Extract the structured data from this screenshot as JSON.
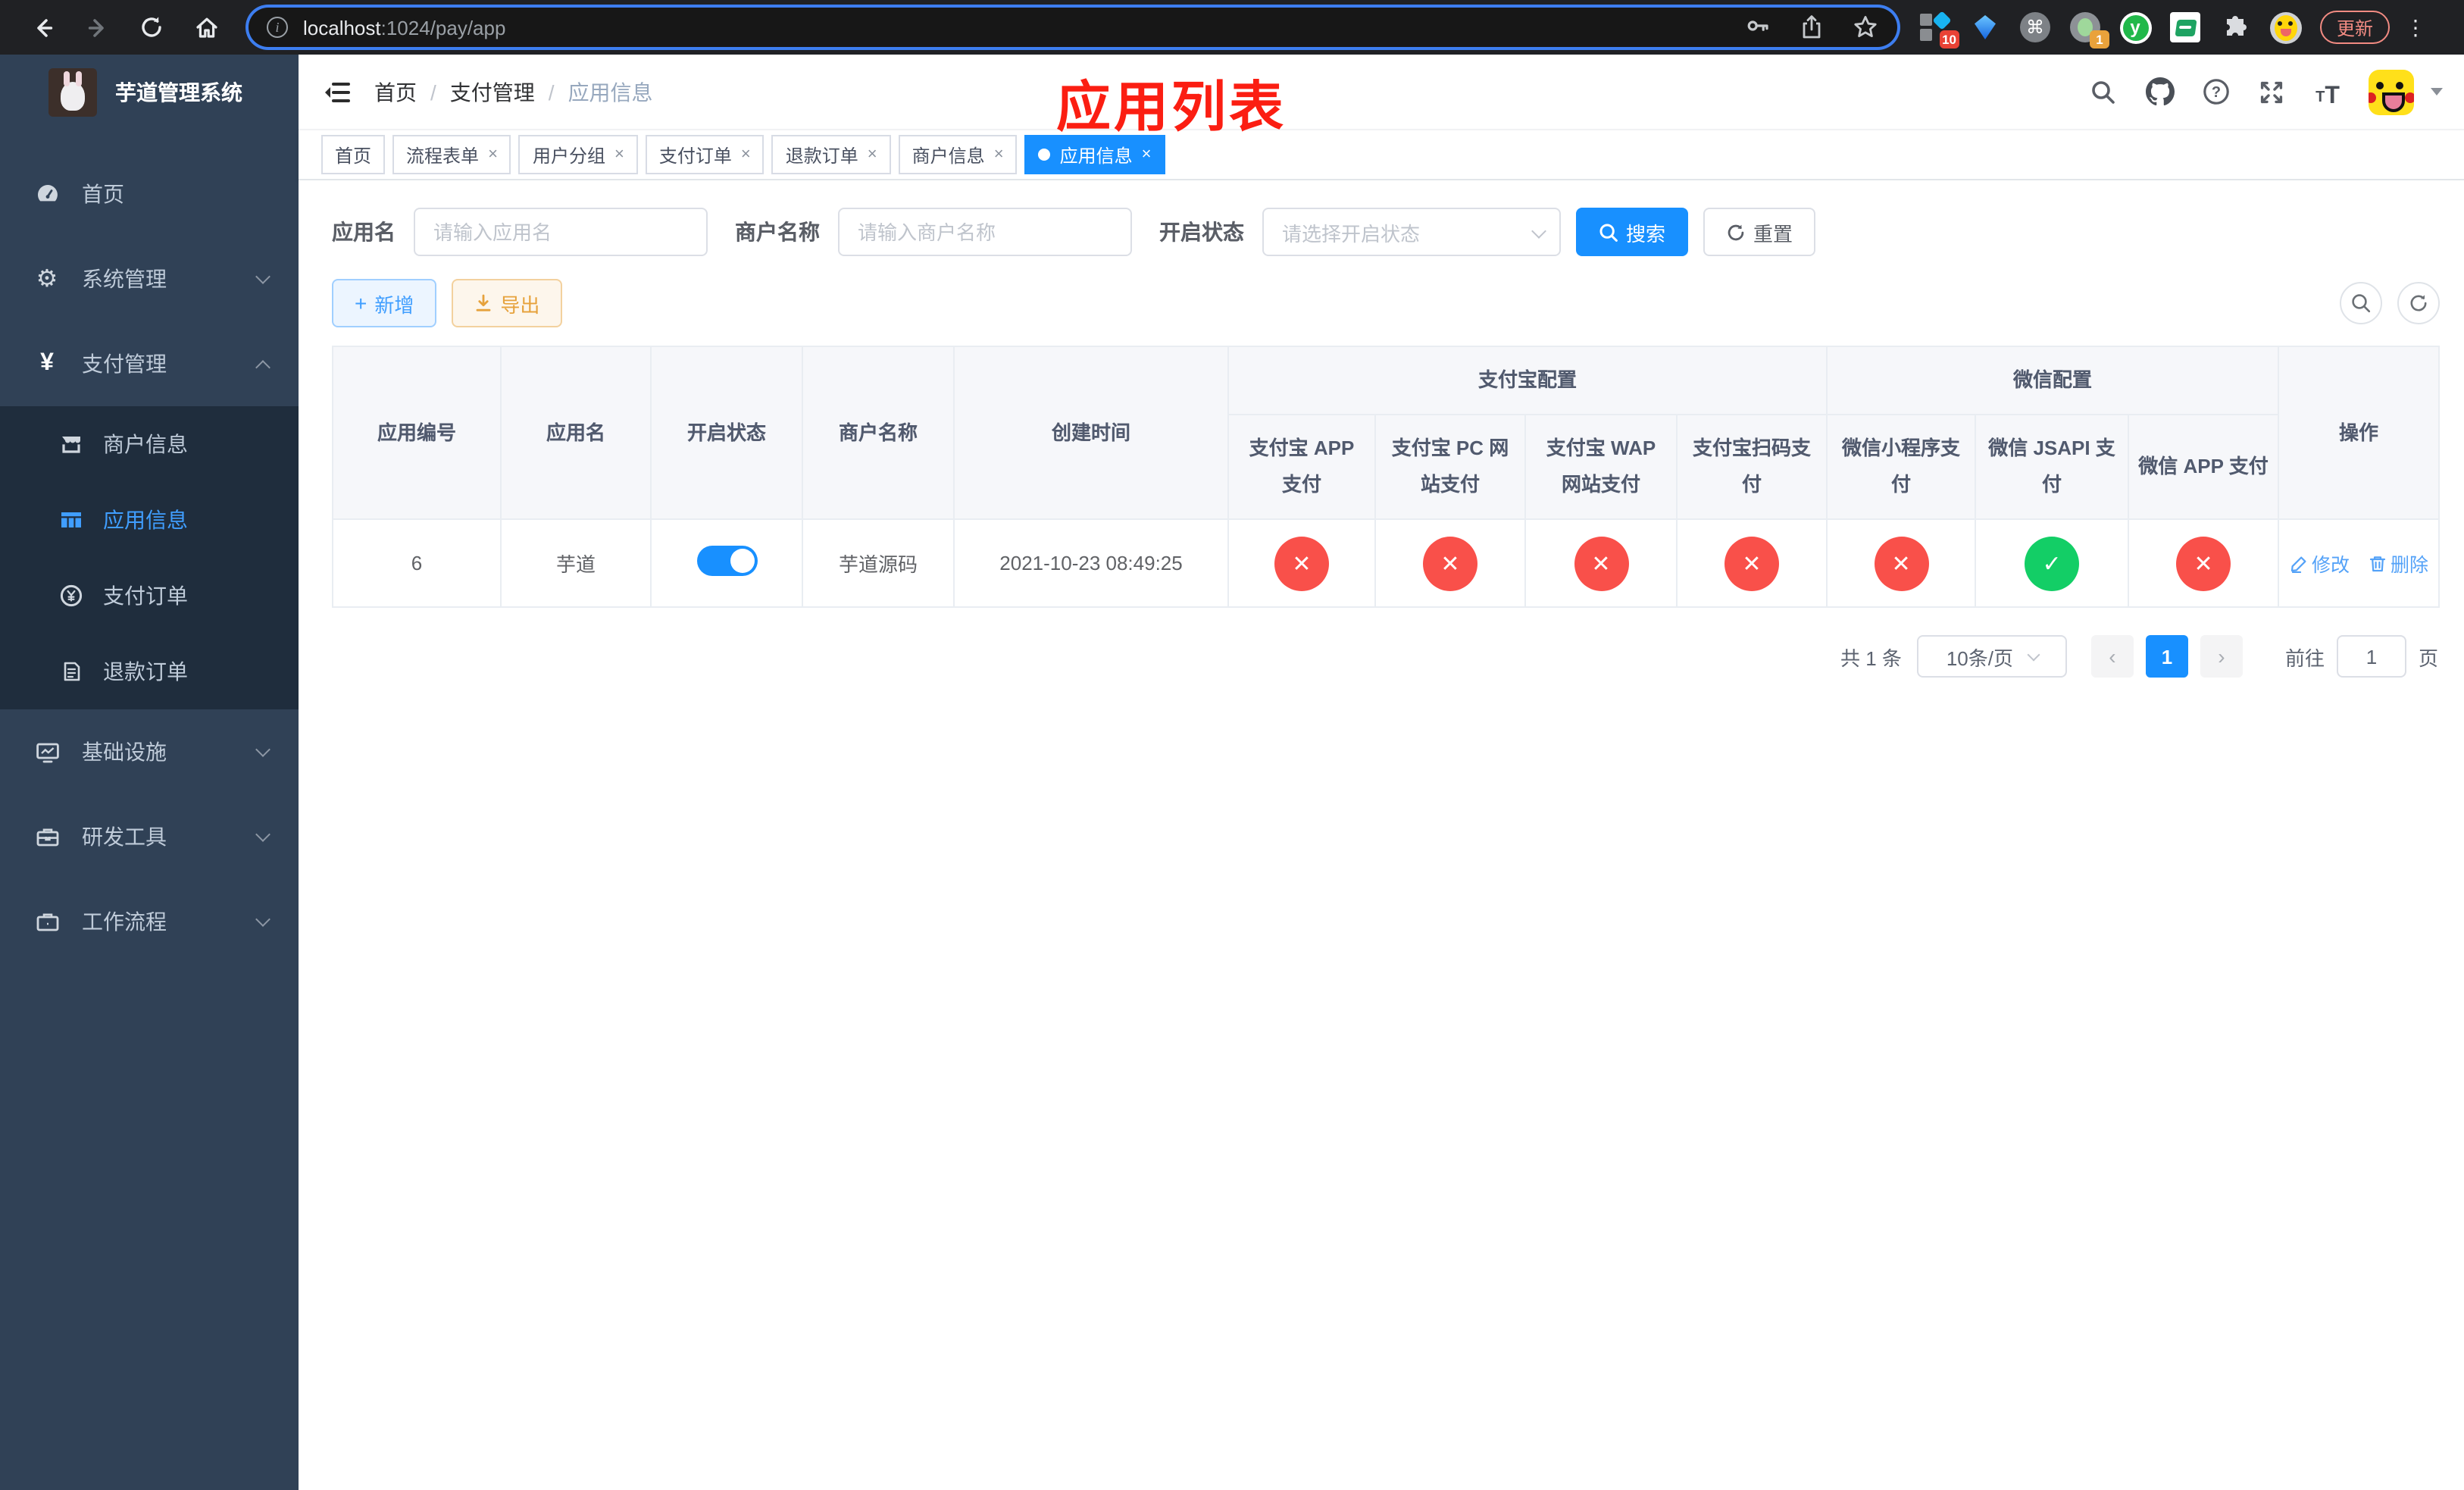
{
  "colors": {
    "accent": "#1890ff",
    "link": "#409eff",
    "danger": "#f9504a",
    "success": "#13ce66",
    "warning": "#e6a23c",
    "sidebar_bg": "#304156",
    "submenu_bg": "#1f2d3d",
    "annotation_red": "#fb1e12"
  },
  "browser": {
    "url_host": "localhost",
    "url_rest": ":1024/pay/app",
    "update_label": "更新",
    "ext_badge_10": "10",
    "ext_badge_1": "1",
    "icons": [
      "back-arrow-icon",
      "forward-arrow-icon",
      "reload-icon",
      "home-icon",
      "info-icon",
      "key-icon",
      "share-icon",
      "star-icon",
      "command-icon",
      "puzzle-icon",
      "kebab-menu-icon"
    ]
  },
  "sidebar": {
    "logo_title": "芋道管理系统",
    "menu": [
      {
        "label": "首页",
        "icon": "dashboard-icon"
      },
      {
        "label": "系统管理",
        "icon": "gear-icon",
        "chevron": "down"
      },
      {
        "label": "支付管理",
        "icon": "yen-icon",
        "chevron": "up"
      },
      {
        "label": "商户信息",
        "icon": "shop-icon"
      },
      {
        "label": "应用信息",
        "icon": "grid-icon",
        "active": true
      },
      {
        "label": "支付订单",
        "icon": "pay-order-icon"
      },
      {
        "label": "退款订单",
        "icon": "refund-doc-icon"
      },
      {
        "label": "基础设施",
        "icon": "monitor-icon",
        "chevron": "down"
      },
      {
        "label": "研发工具",
        "icon": "toolbox-icon",
        "chevron": "down"
      },
      {
        "label": "工作流程",
        "icon": "briefcase-icon",
        "chevron": "down"
      }
    ]
  },
  "navbar": {
    "breadcrumb": [
      "首页",
      "支付管理",
      "应用信息"
    ],
    "separator": "/",
    "annotation": "应用列表",
    "icons": [
      "search-icon",
      "github-icon",
      "help-icon",
      "fullscreen-icon",
      "font-size-icon",
      "avatar",
      "caret-down-icon"
    ]
  },
  "tags": [
    {
      "label": "首页"
    },
    {
      "label": "流程表单",
      "close": "×"
    },
    {
      "label": "用户分组",
      "close": "×"
    },
    {
      "label": "支付订单",
      "close": "×"
    },
    {
      "label": "退款订单",
      "close": "×"
    },
    {
      "label": "商户信息",
      "close": "×"
    },
    {
      "label": "应用信息",
      "close": "×",
      "active": true
    }
  ],
  "filters": {
    "app_name_label": "应用名",
    "app_name_placeholder": "请输入应用名",
    "merchant_label": "商户名称",
    "merchant_placeholder": "请输入商户名称",
    "status_label": "开启状态",
    "status_placeholder": "请选择开启状态",
    "search_label": "搜索",
    "reset_label": "重置"
  },
  "toolbar": {
    "add_label": "新增",
    "export_label": "导出"
  },
  "table": {
    "headers": {
      "app_id": "应用编号",
      "app_name": "应用名",
      "status": "开启状态",
      "merchant": "商户名称",
      "created": "创建时间",
      "alipay_group": "支付宝配置",
      "wechat_group": "微信配置",
      "actions": "操作",
      "channels": [
        "支付宝 APP 支付",
        "支付宝 PC 网站支付",
        "支付宝 WAP 网站支付",
        "支付宝扫码支付",
        "微信小程序支付",
        "微信 JSAPI 支付",
        "微信 APP 支付"
      ]
    },
    "row": {
      "app_id": "6",
      "app_name": "芋道",
      "enabled": "on",
      "merchant": "芋道源码",
      "created": "2021-10-23 08:49:25",
      "channel_states": [
        "cross",
        "cross",
        "cross",
        "cross",
        "cross",
        "check",
        "cross"
      ],
      "edit_label": "修改",
      "delete_label": "删除"
    }
  },
  "pagination": {
    "total": "共 1 条",
    "page_size": "10条/页",
    "prev": "‹",
    "next": "›",
    "page": "1",
    "goto_label": "前往",
    "goto_value": "1",
    "unit": "页"
  }
}
